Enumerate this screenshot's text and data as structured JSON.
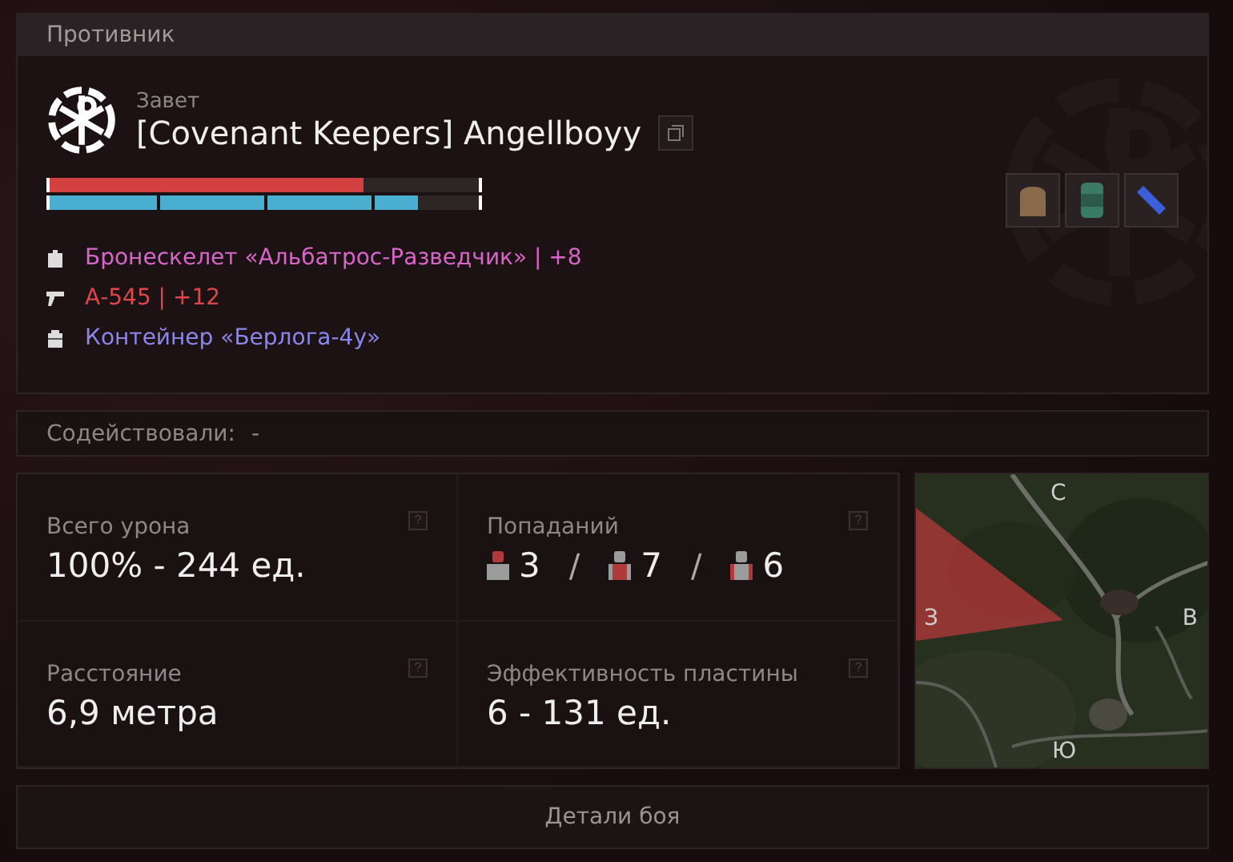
{
  "header": {
    "title": "Противник"
  },
  "enemy": {
    "faction": "Завет",
    "name": "[Covenant Keepers] Angellboyy",
    "health": {
      "level": 0.73
    },
    "armor": {
      "level": 0.86
    },
    "quick_items": [
      {
        "kind": "bread"
      },
      {
        "kind": "can"
      },
      {
        "kind": "tube"
      }
    ],
    "equipment": [
      {
        "kind": "armor",
        "text": "Бронескелет «Альбатрос-Разведчик» | +8",
        "color": "#d865c8"
      },
      {
        "kind": "weapon",
        "text": "А-545 | +12",
        "color": "#e0474b"
      },
      {
        "kind": "container",
        "text": "Контейнер «Берлога-4у»",
        "color": "#8a86ea"
      }
    ]
  },
  "assists": {
    "label": "Содействовали:",
    "value": "-"
  },
  "stats": [
    {
      "kind": "text",
      "label": "Всего урона",
      "value": "100% - 244 ед.",
      "help": "?"
    },
    {
      "kind": "hits",
      "label": "Попаданий",
      "help": "?",
      "hits": [
        {
          "kind": "head",
          "count": "3"
        },
        {
          "kind": "torso",
          "count": "7"
        },
        {
          "kind": "limbs",
          "count": "6"
        }
      ],
      "separator": "/"
    },
    {
      "kind": "text",
      "label": "Расстояние",
      "value": "6,9 метра",
      "help": "?"
    },
    {
      "kind": "text",
      "label": "Эффективность пластины",
      "value": "6 - 131 ед.",
      "help": "?"
    }
  ],
  "map": {
    "north": "С",
    "east": "В",
    "south": "Ю",
    "west": "З"
  },
  "details_button": "Детали боя"
}
